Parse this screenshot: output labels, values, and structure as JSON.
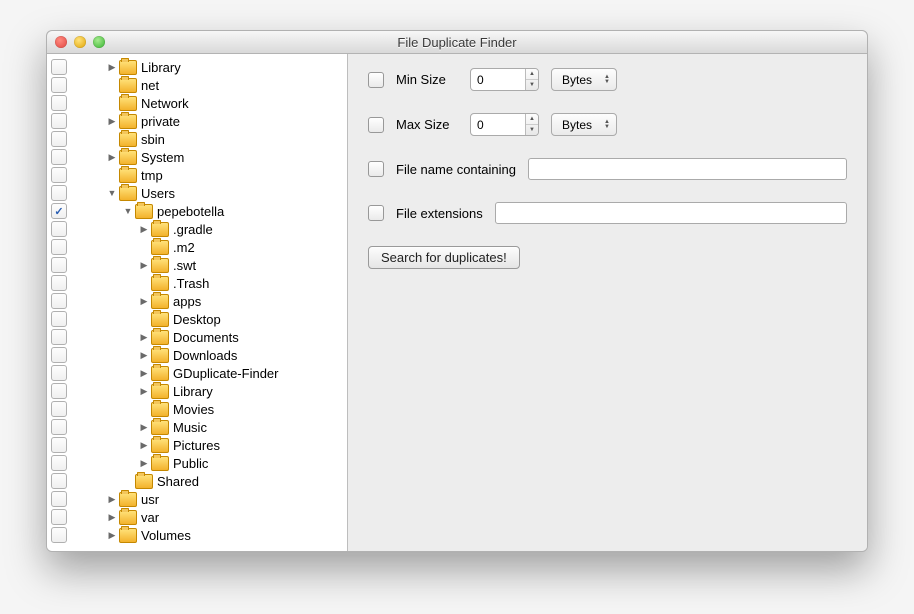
{
  "window": {
    "title": "File Duplicate Finder"
  },
  "sidebar": {
    "items": [
      {
        "label": "Library",
        "indent": 1,
        "arrow": "right",
        "checked": false
      },
      {
        "label": "net",
        "indent": 1,
        "arrow": "none",
        "checked": false
      },
      {
        "label": "Network",
        "indent": 1,
        "arrow": "none",
        "checked": false
      },
      {
        "label": "private",
        "indent": 1,
        "arrow": "right",
        "checked": false
      },
      {
        "label": "sbin",
        "indent": 1,
        "arrow": "none",
        "checked": false
      },
      {
        "label": "System",
        "indent": 1,
        "arrow": "right",
        "checked": false
      },
      {
        "label": "tmp",
        "indent": 1,
        "arrow": "none",
        "checked": false
      },
      {
        "label": "Users",
        "indent": 1,
        "arrow": "down",
        "checked": false
      },
      {
        "label": "pepebotella",
        "indent": 2,
        "arrow": "down",
        "checked": true
      },
      {
        "label": ".gradle",
        "indent": 3,
        "arrow": "right",
        "checked": false
      },
      {
        "label": ".m2",
        "indent": 3,
        "arrow": "none",
        "checked": false
      },
      {
        "label": ".swt",
        "indent": 3,
        "arrow": "right",
        "checked": false
      },
      {
        "label": ".Trash",
        "indent": 3,
        "arrow": "none",
        "checked": false
      },
      {
        "label": "apps",
        "indent": 3,
        "arrow": "right",
        "checked": false
      },
      {
        "label": "Desktop",
        "indent": 3,
        "arrow": "none",
        "checked": false
      },
      {
        "label": "Documents",
        "indent": 3,
        "arrow": "right",
        "checked": false
      },
      {
        "label": "Downloads",
        "indent": 3,
        "arrow": "right",
        "checked": false
      },
      {
        "label": "GDuplicate-Finder",
        "indent": 3,
        "arrow": "right",
        "checked": false
      },
      {
        "label": "Library",
        "indent": 3,
        "arrow": "right",
        "checked": false
      },
      {
        "label": "Movies",
        "indent": 3,
        "arrow": "none",
        "checked": false
      },
      {
        "label": "Music",
        "indent": 3,
        "arrow": "right",
        "checked": false
      },
      {
        "label": "Pictures",
        "indent": 3,
        "arrow": "right",
        "checked": false
      },
      {
        "label": "Public",
        "indent": 3,
        "arrow": "right",
        "checked": false
      },
      {
        "label": "Shared",
        "indent": 2,
        "arrow": "none",
        "checked": false
      },
      {
        "label": "usr",
        "indent": 1,
        "arrow": "right",
        "checked": false
      },
      {
        "label": "var",
        "indent": 1,
        "arrow": "right",
        "checked": false
      },
      {
        "label": "Volumes",
        "indent": 1,
        "arrow": "right",
        "checked": false
      }
    ]
  },
  "panel": {
    "minSize": {
      "label": "Min Size",
      "value": "0",
      "unit": "Bytes"
    },
    "maxSize": {
      "label": "Max Size",
      "value": "0",
      "unit": "Bytes"
    },
    "nameContains": {
      "label": "File name containing",
      "value": ""
    },
    "extensions": {
      "label": "File extensions",
      "value": ""
    },
    "searchButton": "Search for duplicates!"
  }
}
